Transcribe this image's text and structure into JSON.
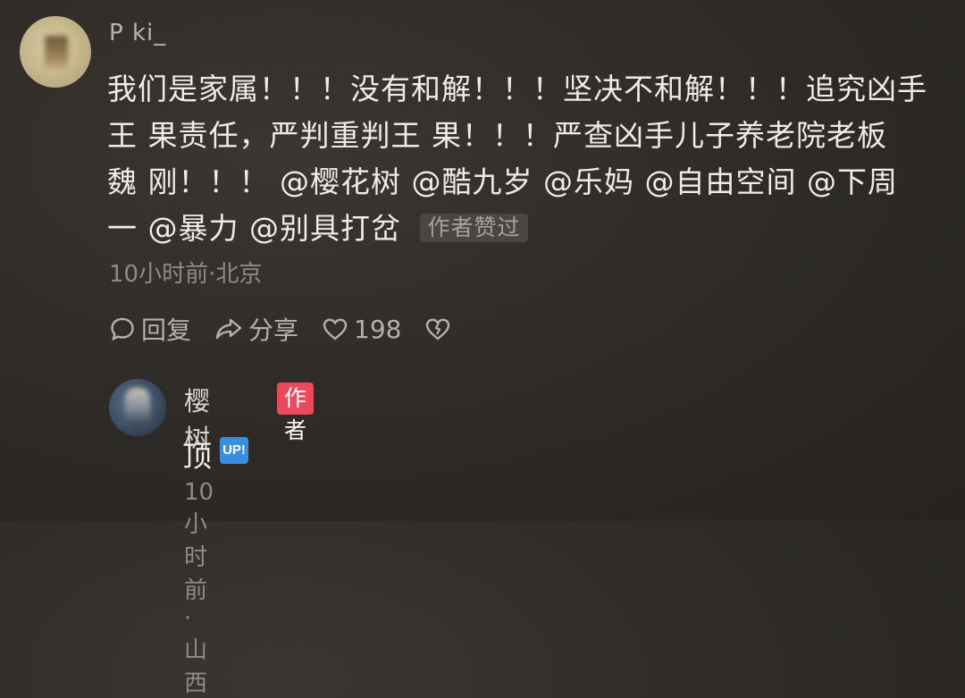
{
  "comment": {
    "username": "P ki_",
    "text_line_1": "我们是家属！！！没有和解！！！坚决不和解！！！追究凶手",
    "text_line_2": "王 果责任，严判重判王 果！！！严查凶手儿子养老院老板",
    "text_line_3": "魏 刚！！！ @樱花树 @酷九岁 @乐妈 @自由空间 @下周",
    "text_line_4": "一 @暴力 @别具打岔",
    "liked_badge": "作者赞过",
    "meta": "10小时前·北京",
    "actions": {
      "reply_label": "回复",
      "share_label": "分享",
      "like_count": "198"
    },
    "icons": [
      "comment-icon",
      "share-icon",
      "heart-icon",
      "dislike-icon"
    ]
  },
  "reply": {
    "username": "樱 树",
    "author_tag": "作者",
    "text": "顶",
    "badge": "UP!",
    "meta": "10小时前·山西"
  },
  "colors": {
    "author_tag_bg": "#e94b5c",
    "up_badge_bg": "#3a8ee0"
  }
}
